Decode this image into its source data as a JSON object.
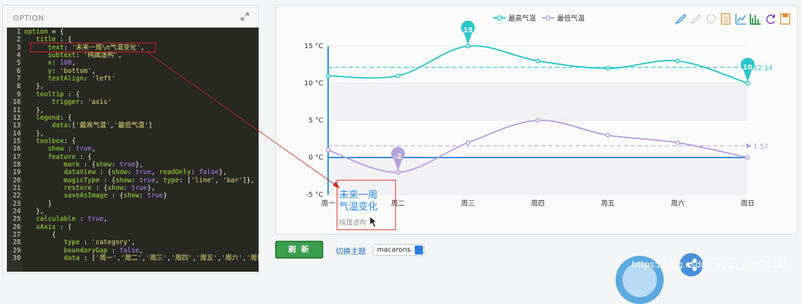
{
  "left_panel": {
    "title": "OPTION",
    "expand_icon": "expand-arrows-icon",
    "code_lines": [
      [
        [
          "option",
          "k"
        ],
        [
          " = {",
          "w"
        ]
      ],
      [
        [
          "   title",
          "k"
        ],
        [
          " : {",
          "w"
        ]
      ],
      [
        [
          "      text",
          "k"
        ],
        [
          ": ",
          "w"
        ],
        [
          "'未来一周\\n气温变化'",
          "s"
        ],
        [
          ",",
          "w"
        ]
      ],
      [
        [
          "      subtext",
          "k"
        ],
        [
          ": ",
          "w"
        ],
        [
          "'纯属虚构'",
          "s"
        ],
        [
          ",",
          "w"
        ]
      ],
      [
        [
          "      x",
          "k"
        ],
        [
          ": ",
          "w"
        ],
        [
          "100",
          "c"
        ],
        [
          ",",
          "w"
        ]
      ],
      [
        [
          "      y",
          "k"
        ],
        [
          ": ",
          "w"
        ],
        [
          "'bottom'",
          "s"
        ],
        [
          ",",
          "w"
        ]
      ],
      [
        [
          "      textAlign",
          "k"
        ],
        [
          ": ",
          "w"
        ],
        [
          "'left'",
          "s"
        ]
      ],
      [
        [
          "   },",
          "w"
        ]
      ],
      [
        [
          "   tooltip",
          "k"
        ],
        [
          " : {",
          "w"
        ]
      ],
      [
        [
          "       trigger",
          "k"
        ],
        [
          ": ",
          "w"
        ],
        [
          "'axis'",
          "s"
        ]
      ],
      [
        [
          "   },",
          "w"
        ]
      ],
      [
        [
          "   legend",
          "k"
        ],
        [
          ": {",
          "w"
        ]
      ],
      [
        [
          "       data",
          "k"
        ],
        [
          ":[",
          "w"
        ],
        [
          "'最高气温'",
          "s"
        ],
        [
          ",",
          "w"
        ],
        [
          "'最低气温'",
          "s"
        ],
        [
          "]",
          "w"
        ]
      ],
      [
        [
          "   },",
          "w"
        ]
      ],
      [
        [
          "   toolbox",
          "k"
        ],
        [
          ": {",
          "w"
        ]
      ],
      [
        [
          "      show",
          "k"
        ],
        [
          " : ",
          "w"
        ],
        [
          "true",
          "c"
        ],
        [
          ",",
          "w"
        ]
      ],
      [
        [
          "      feature",
          "k"
        ],
        [
          " : {",
          "w"
        ]
      ],
      [
        [
          "          mark",
          "k"
        ],
        [
          " : {",
          "w"
        ],
        [
          "show",
          "k"
        ],
        [
          ": ",
          "w"
        ],
        [
          "true",
          "c"
        ],
        [
          "},",
          "w"
        ]
      ],
      [
        [
          "          dataView",
          "k"
        ],
        [
          " : {",
          "w"
        ],
        [
          "show",
          "k"
        ],
        [
          ": ",
          "w"
        ],
        [
          "true",
          "c"
        ],
        [
          ", ",
          "w"
        ],
        [
          "readOnly",
          "k"
        ],
        [
          ": ",
          "w"
        ],
        [
          "false",
          "c"
        ],
        [
          "},",
          "w"
        ]
      ],
      [
        [
          "          magicType",
          "k"
        ],
        [
          " : {",
          "w"
        ],
        [
          "show",
          "k"
        ],
        [
          ": ",
          "w"
        ],
        [
          "true",
          "c"
        ],
        [
          ", ",
          "w"
        ],
        [
          "type",
          "k"
        ],
        [
          ": [",
          "w"
        ],
        [
          "'line'",
          "s"
        ],
        [
          ", ",
          "w"
        ],
        [
          "'bar'",
          "s"
        ],
        [
          "]},",
          "w"
        ]
      ],
      [
        [
          "          restore",
          "k"
        ],
        [
          " : {",
          "w"
        ],
        [
          "show",
          "k"
        ],
        [
          ": ",
          "w"
        ],
        [
          "true",
          "c"
        ],
        [
          "},",
          "w"
        ]
      ],
      [
        [
          "          saveAsImage",
          "k"
        ],
        [
          " : {",
          "w"
        ],
        [
          "show",
          "k"
        ],
        [
          ": ",
          "w"
        ],
        [
          "true",
          "c"
        ],
        [
          "}",
          "w"
        ]
      ],
      [
        [
          "      }",
          "w"
        ]
      ],
      [
        [
          "   },",
          "w"
        ]
      ],
      [
        [
          "   calculable",
          "k"
        ],
        [
          " : ",
          "w"
        ],
        [
          "true",
          "c"
        ],
        [
          ",",
          "w"
        ]
      ],
      [
        [
          "   xAxis",
          "k"
        ],
        [
          " : [",
          "w"
        ]
      ],
      [
        [
          "       {",
          "w"
        ]
      ],
      [
        [
          "          type",
          "k"
        ],
        [
          " : ",
          "w"
        ],
        [
          "'category'",
          "s"
        ],
        [
          ",",
          "w"
        ]
      ],
      [
        [
          "          boundaryGap",
          "k"
        ],
        [
          " : ",
          "w"
        ],
        [
          "false",
          "c"
        ],
        [
          ",",
          "w"
        ]
      ],
      [
        [
          "          data",
          "k"
        ],
        [
          " : [",
          "w"
        ],
        [
          "'周一'",
          "s"
        ],
        [
          ",",
          "w"
        ],
        [
          "'周二'",
          "s"
        ],
        [
          ",",
          "w"
        ],
        [
          "'周三'",
          "s"
        ],
        [
          ",",
          "w"
        ],
        [
          "'周四'",
          "s"
        ],
        [
          ",",
          "w"
        ],
        [
          "'周五'",
          "s"
        ],
        [
          ",",
          "w"
        ],
        [
          "'周六'",
          "s"
        ],
        [
          ",",
          "w"
        ],
        [
          "'周日'",
          "s"
        ],
        [
          "]",
          "w"
        ]
      ]
    ]
  },
  "toolbox_icons": [
    "mark-pen-icon",
    "mark-undo-icon",
    "mark-clear-icon",
    "data-view-icon",
    "line-chart-icon",
    "bar-chart-icon",
    "restore-icon",
    "save-image-icon"
  ],
  "controls": {
    "refresh_label": "刷 新",
    "theme_label": "切换主题",
    "theme_value": "macarons"
  },
  "watermark": "https://blog.csdn.net/qq_39928481",
  "colors": {
    "max": "#2ec7c9",
    "min": "#b6a2de",
    "axis": "#2a8ce0",
    "accent": "#3b9e4e"
  },
  "chart_data": {
    "type": "line",
    "categories": [
      "周一",
      "周二",
      "周三",
      "周四",
      "周五",
      "周六",
      "周日"
    ],
    "series": [
      {
        "name": "最高气温",
        "values": [
          11,
          11,
          15,
          13,
          12,
          13,
          10
        ],
        "color": "#2ec7c9",
        "markPoint": {
          "max": "15",
          "min": "10"
        },
        "markLine": {
          "average": "12.14"
        }
      },
      {
        "name": "最低气温",
        "values": [
          1,
          -2,
          2,
          5,
          3,
          2,
          0
        ],
        "color": "#b6a2de",
        "markPoint": {
          "min": "-2"
        },
        "markLine": {
          "average": "1.57"
        }
      }
    ],
    "yticks": [
      "15 °C",
      "10 °C",
      "5 °C",
      "0 °C",
      "-5 °C"
    ],
    "ylim": [
      -5,
      15
    ],
    "title": "未来一周\n气温变化",
    "subtitle": "纯属虚构",
    "legend_position": "top-center"
  }
}
